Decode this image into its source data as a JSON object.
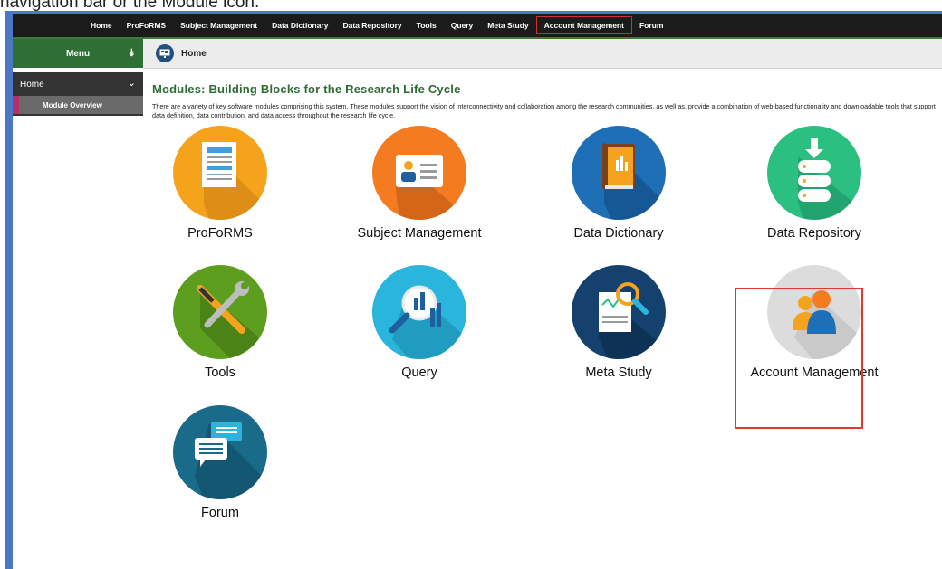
{
  "caption": "navigation bar or the Module icon.",
  "topnav": {
    "items": [
      "Home",
      "ProFoRMS",
      "Subject Management",
      "Data Dictionary",
      "Data Repository",
      "Tools",
      "Query",
      "Meta Study",
      "Account Management",
      "Forum"
    ]
  },
  "sidebar": {
    "menu_title": "Menu",
    "home_label": "Home",
    "sub_item": "Module Overview"
  },
  "breadcrumb": {
    "current": "Home"
  },
  "page": {
    "title": "Modules: Building Blocks for the Research Life Cycle",
    "intro": "There are a variety of key software modules comprising this system. These modules support the vision of interconnectivity and collaboration among the research communities, as well as, provide a combination of web-based functionality and downloadable tools that support data definition, data contribution, and data access throughout the research life cycle."
  },
  "modules": [
    {
      "label": "ProFoRMS",
      "icon": "form-document-icon",
      "color": "#f5a31c"
    },
    {
      "label": "Subject Management",
      "icon": "id-card-icon",
      "color": "#f47b20"
    },
    {
      "label": "Data Dictionary",
      "icon": "book-icon",
      "color": "#1e6fb5"
    },
    {
      "label": "Data Repository",
      "icon": "database-download-icon",
      "color": "#2bbf82"
    },
    {
      "label": "Tools",
      "icon": "wrench-screwdriver-icon",
      "color": "#5e9e1f"
    },
    {
      "label": "Query",
      "icon": "magnifier-chart-icon",
      "color": "#2ab5dc"
    },
    {
      "label": "Meta Study",
      "icon": "report-magnifier-icon",
      "color": "#15416e"
    },
    {
      "label": "Account Management",
      "icon": "users-icon",
      "color": "#dcdcdc"
    },
    {
      "label": "Forum",
      "icon": "chat-bubbles-icon",
      "color": "#1a6a8a"
    }
  ]
}
